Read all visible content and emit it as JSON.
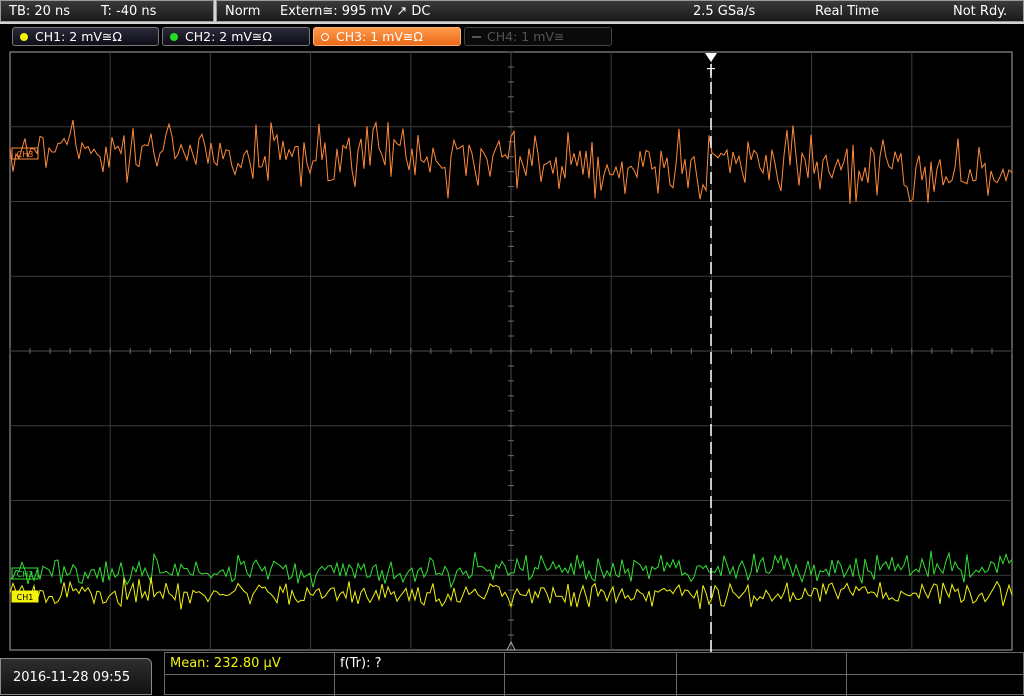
{
  "timebase": {
    "tb": "TB: 20 ns",
    "trigger_time": "T: -40 ns"
  },
  "status": {
    "mode": "Norm",
    "trigger": "Extern≅: 995 mV ↗ DC",
    "sample_rate": "2.5 GSa/s",
    "acq_mode": "Real Time",
    "run_state": "Not Rdy."
  },
  "channels": [
    {
      "label": "CH1: 2 mV≅Ω",
      "color": "#f2f20e",
      "state": "on"
    },
    {
      "label": "CH2: 2 mV≅Ω",
      "color": "#22dd22",
      "state": "on"
    },
    {
      "label": "CH3: 1 mV≅Ω",
      "color": "#ff8a3a",
      "state": "active"
    },
    {
      "label": "CH4: 1 mV≅",
      "color": "#555555",
      "state": "off"
    }
  ],
  "markers": {
    "trigger_marker": "T",
    "ch3_marker": "CH3",
    "ch2_marker": "CH2",
    "ch1_marker": "CH1"
  },
  "footer": {
    "datetime": "2016-11-28 09:55",
    "mean": "Mean: 232.80 µV",
    "freq": "f(Tr): ?"
  }
}
